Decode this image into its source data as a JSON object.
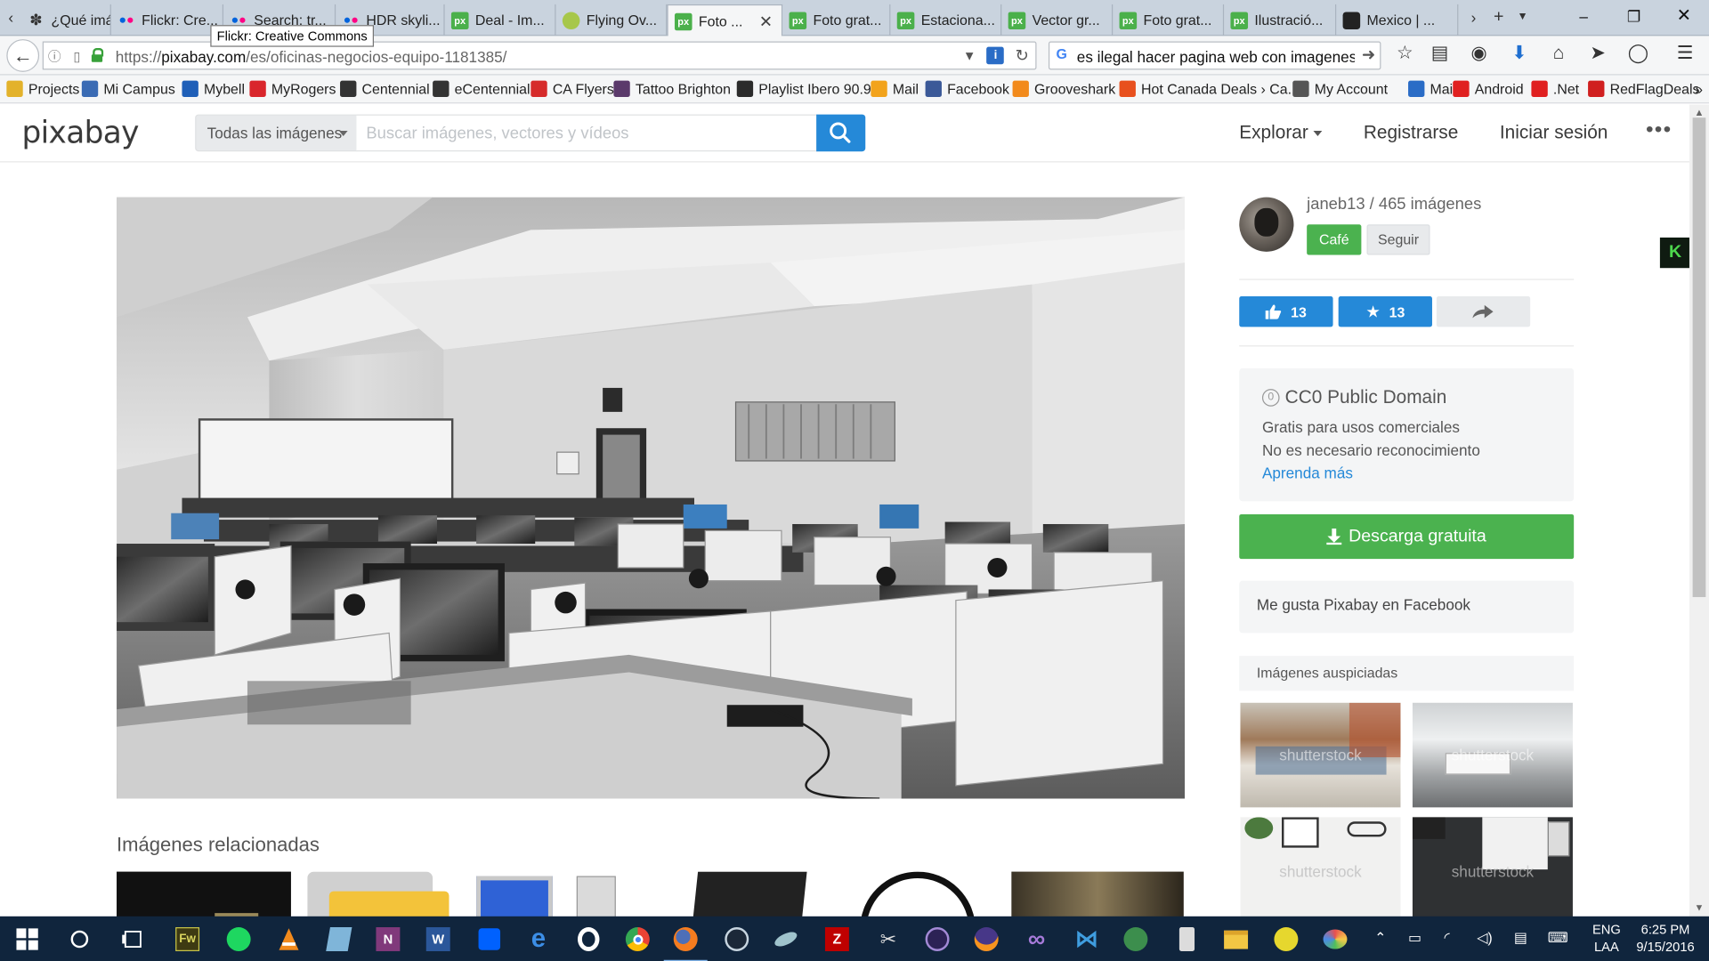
{
  "browser": {
    "tabs": [
      {
        "label": "¿Qué imá...",
        "favicon": "ie-icon"
      },
      {
        "label": "Flickr: Cre...",
        "favicon": "flickr-icon"
      },
      {
        "label": "Search: tr...",
        "favicon": "flickr-icon"
      },
      {
        "label": "HDR skyli...",
        "favicon": "flickr-icon"
      },
      {
        "label": "Deal - Im...",
        "favicon": "pixabay-icon"
      },
      {
        "label": "Flying Ov...",
        "favicon": "lime-icon"
      },
      {
        "label": "Foto ...",
        "favicon": "pixabay-icon",
        "active": true
      },
      {
        "label": "Foto grat...",
        "favicon": "pixabay-icon"
      },
      {
        "label": "Estaciona...",
        "favicon": "pixabay-icon"
      },
      {
        "label": "Vector gr...",
        "favicon": "pixabay-icon"
      },
      {
        "label": "Foto grat...",
        "favicon": "pixabay-icon"
      },
      {
        "label": "Ilustració...",
        "favicon": "pixabay-icon"
      },
      {
        "label": "Mexico | ...",
        "favicon": "camera-icon"
      }
    ],
    "tooltip": "Flickr: Creative Commons",
    "url_prefix": "https://",
    "url_host": "pixabay.com",
    "url_path": "/es/oficinas-negocios-equipo-1181385/",
    "search_text": "es ilegal hacer pagina web con imagenes",
    "bookmarks": [
      {
        "label": "Projects",
        "color": "#e3b22b"
      },
      {
        "label": "Mi Campus",
        "color": "#3a6bb4"
      },
      {
        "label": "Mybell",
        "color": "#1f5fb8"
      },
      {
        "label": "MyRogers",
        "color": "#d9262c"
      },
      {
        "label": "Centennial",
        "color": "#333333"
      },
      {
        "label": "eCentennial",
        "color": "#333333"
      },
      {
        "label": "CA Flyers",
        "color": "#d62b2b"
      },
      {
        "label": "Tattoo Brighton",
        "color": "#5b3a6b"
      },
      {
        "label": "Playlist Ibero 90.9",
        "color": "#2b2b2b"
      },
      {
        "label": "Mail",
        "color": "#f2a31c"
      },
      {
        "label": "Facebook",
        "color": "#3b5998"
      },
      {
        "label": "Grooveshark",
        "color": "#f28a1c"
      },
      {
        "label": "Hot Canada Deals › Ca...",
        "color": "#e8501e"
      },
      {
        "label": "My Account",
        "color": "#555555"
      },
      {
        "label": "Mail",
        "color": "#2a6cc6"
      },
      {
        "label": "Android",
        "color": "#e02020"
      },
      {
        "label": ".Net",
        "color": "#e02020"
      },
      {
        "label": "RedFlagDeals",
        "color": "#d01f1f"
      }
    ]
  },
  "header": {
    "logo": "pixabay",
    "filter_label": "Todas las imágenes",
    "search_placeholder": "Buscar imágenes, vectores y vídeos",
    "nav": [
      "Explorar",
      "Registrarse",
      "Iniciar sesión"
    ]
  },
  "main": {
    "related_title": "Imágenes relacionadas"
  },
  "sidebar": {
    "username": "janeb13",
    "images_count": "465 imágenes",
    "cafe_label": "Café",
    "follow_label": "Seguir",
    "likes": "13",
    "favorites": "13",
    "license_title": "CC0 Public Domain",
    "license_line1": "Gratis para usos comerciales",
    "license_line2": "No es necesario reconocimiento",
    "license_link": "Aprenda más",
    "download_label": "Descarga gratuita",
    "facebook_label": "Me gusta Pixabay en Facebook",
    "sponsored_label": "Imágenes auspiciadas",
    "watermark": "shutterstock",
    "k_badge": "K"
  },
  "taskbar": {
    "lang_top": "ENG",
    "lang_bottom": "LAA",
    "time": "6:25 PM",
    "date": "9/15/2016"
  },
  "colors": {
    "pixabay_blue": "#2589d8",
    "pixabay_green": "#4bb24f",
    "taskbar": "#10253d"
  }
}
